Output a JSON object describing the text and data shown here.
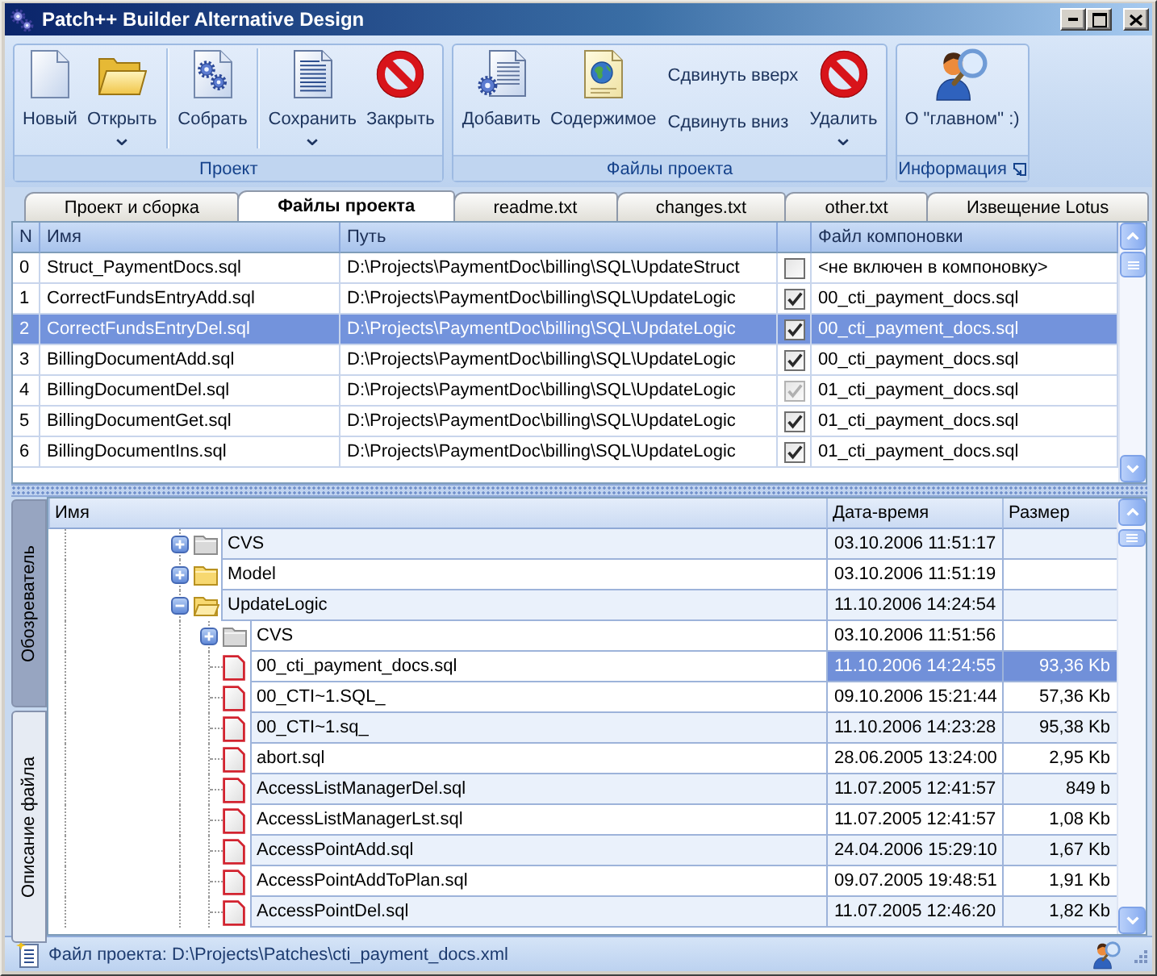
{
  "window": {
    "title": "Patch++ Builder Alternative Design"
  },
  "ribbon": {
    "groups": [
      {
        "label": "Проект",
        "sections": [
          [
            {
              "kind": "large",
              "label": "Новый",
              "dropdown": false
            },
            {
              "kind": "large",
              "label": "Открыть",
              "dropdown": true
            }
          ],
          [
            {
              "kind": "large",
              "label": "Собрать",
              "dropdown": false
            }
          ],
          [
            {
              "kind": "large",
              "label": "Сохранить",
              "dropdown": true
            },
            {
              "kind": "large",
              "label": "Закрыть",
              "dropdown": false
            }
          ]
        ]
      },
      {
        "label": "Файлы проекта",
        "sections": [
          [
            {
              "kind": "large",
              "label": "Добавить",
              "dropdown": false
            },
            {
              "kind": "large",
              "label": "Содержимое",
              "dropdown": false
            },
            {
              "kind": "stack",
              "buttons": [
                "Сдвинуть вверх",
                "Сдвинуть вниз"
              ]
            },
            {
              "kind": "large",
              "label": "Удалить",
              "dropdown": true
            }
          ]
        ]
      },
      {
        "label": "Информация",
        "launcher": true,
        "sections": [
          [
            {
              "kind": "large",
              "label": "О \"главном\" :)",
              "dropdown": false
            }
          ]
        ]
      }
    ]
  },
  "tabs": [
    {
      "label": "Проект и сборка",
      "selected": false
    },
    {
      "label": "Файлы проекта",
      "selected": true
    },
    {
      "label": "readme.txt",
      "selected": false
    },
    {
      "label": "changes.txt",
      "selected": false
    },
    {
      "label": "other.txt",
      "selected": false
    },
    {
      "label": "Извещение Lotus",
      "selected": false
    }
  ],
  "files_table": {
    "columns": [
      {
        "kind": "text",
        "label": "N"
      },
      {
        "kind": "text",
        "label": "Имя"
      },
      {
        "kind": "text",
        "label": "Путь"
      },
      {
        "kind": "check"
      },
      {
        "kind": "text",
        "label": "Файл компоновки"
      }
    ],
    "rows": [
      {
        "n": "0",
        "name": "Struct_PaymentDocs.sql",
        "path": "D:\\Projects\\PaymentDoc\\billing\\SQL\\UpdateStruct",
        "checked": false,
        "disabled": false,
        "layout_file": "<не включен в компоновку>",
        "selected": false
      },
      {
        "n": "1",
        "name": "CorrectFundsEntryAdd.sql",
        "path": "D:\\Projects\\PaymentDoc\\billing\\SQL\\UpdateLogic",
        "checked": true,
        "disabled": false,
        "layout_file": "00_cti_payment_docs.sql",
        "selected": false
      },
      {
        "n": "2",
        "name": "CorrectFundsEntryDel.sql",
        "path": "D:\\Projects\\PaymentDoc\\billing\\SQL\\UpdateLogic",
        "checked": true,
        "disabled": false,
        "layout_file": "00_cti_payment_docs.sql",
        "selected": true
      },
      {
        "n": "3",
        "name": "BillingDocumentAdd.sql",
        "path": "D:\\Projects\\PaymentDoc\\billing\\SQL\\UpdateLogic",
        "checked": true,
        "disabled": false,
        "layout_file": "00_cti_payment_docs.sql",
        "selected": false
      },
      {
        "n": "4",
        "name": "BillingDocumentDel.sql",
        "path": "D:\\Projects\\PaymentDoc\\billing\\SQL\\UpdateLogic",
        "checked": true,
        "disabled": true,
        "layout_file": "01_cti_payment_docs.sql",
        "selected": false
      },
      {
        "n": "5",
        "name": "BillingDocumentGet.sql",
        "path": "D:\\Projects\\PaymentDoc\\billing\\SQL\\UpdateLogic",
        "checked": true,
        "disabled": false,
        "layout_file": "01_cti_payment_docs.sql",
        "selected": false
      },
      {
        "n": "6",
        "name": "BillingDocumentIns.sql",
        "path": "D:\\Projects\\PaymentDoc\\billing\\SQL\\UpdateLogic",
        "checked": true,
        "disabled": false,
        "layout_file": "01_cti_payment_docs.sql",
        "selected": false
      }
    ]
  },
  "side_tabs": [
    {
      "label": "Обозреватель",
      "selected": true
    },
    {
      "label": "Описание файла",
      "selected": false
    }
  ],
  "browser": {
    "columns": [
      "Имя",
      "Дата-время",
      "Размер"
    ],
    "tree": [
      {
        "kind": "vcsfolder",
        "name": "CVS",
        "date": "03.10.2006 11:51:17",
        "expanded": false,
        "selected": false
      },
      {
        "kind": "folder",
        "name": "Model",
        "date": "03.10.2006 11:51:19",
        "expanded": false,
        "selected": false
      },
      {
        "kind": "folder",
        "name": "UpdateLogic",
        "date": "11.10.2006 14:24:54",
        "expanded": true,
        "selected": false,
        "children": [
          {
            "kind": "vcsfolder",
            "name": "CVS",
            "date": "03.10.2006 11:51:56",
            "expanded": false,
            "selected": false
          },
          {
            "kind": "file",
            "name": "00_cti_payment_docs.sql",
            "date": "11.10.2006 14:24:55",
            "size": "93,36 Kb",
            "selected": true
          },
          {
            "kind": "file",
            "name": "00_CTI~1.SQL_",
            "date": "09.10.2006 15:21:44",
            "size": "57,36 Kb",
            "selected": false
          },
          {
            "kind": "file",
            "name": "00_CTI~1.sq_",
            "date": "11.10.2006 14:23:28",
            "size": "95,38 Kb",
            "selected": false
          },
          {
            "kind": "file",
            "name": "abort.sql",
            "date": "28.06.2005 13:24:00",
            "size": "2,95 Kb",
            "selected": false
          },
          {
            "kind": "file",
            "name": "AccessListManagerDel.sql",
            "date": "11.07.2005 12:41:57",
            "size": "849 b",
            "selected": false
          },
          {
            "kind": "file",
            "name": "AccessListManagerLst.sql",
            "date": "11.07.2005 12:41:57",
            "size": "1,08 Kb",
            "selected": false
          },
          {
            "kind": "file",
            "name": "AccessPointAdd.sql",
            "date": "24.04.2006 15:29:10",
            "size": "1,67 Kb",
            "selected": false
          },
          {
            "kind": "file",
            "name": "AccessPointAddToPlan.sql",
            "date": "09.07.2005 19:48:51",
            "size": "1,91 Kb",
            "selected": false
          },
          {
            "kind": "file",
            "name": "AccessPointDel.sql",
            "date": "11.07.2005 12:46:20",
            "size": "1,82 Kb",
            "selected": false
          }
        ]
      }
    ]
  },
  "status_bar": {
    "text": "Файл проекта: D:\\Projects\\Patches\\cti_payment_docs.xml"
  }
}
